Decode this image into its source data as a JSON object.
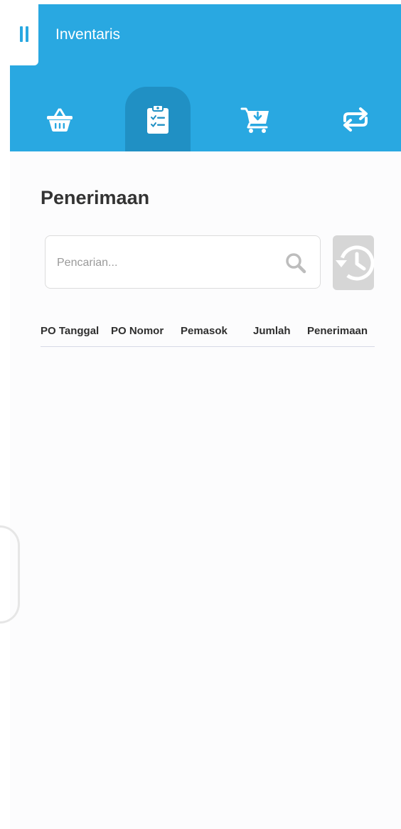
{
  "app": {
    "title": "Inventaris",
    "accent_color": "#29a8e1",
    "active_tab_color": "#2090c4"
  },
  "menu": {
    "icon": "menu-icon"
  },
  "tabs": [
    {
      "icon": "basket-icon",
      "active": false
    },
    {
      "icon": "clipboard-checklist-icon",
      "active": true
    },
    {
      "icon": "cart-download-icon",
      "active": false
    },
    {
      "icon": "swap-arrows-icon",
      "active": false
    }
  ],
  "page": {
    "title": "Penerimaan"
  },
  "search": {
    "placeholder": "Pencarian...",
    "value": "",
    "icon": "search-icon"
  },
  "history_button": {
    "icon": "history-icon"
  },
  "table": {
    "columns": [
      "PO Tanggal",
      "PO Nomor",
      "Pemasok",
      "Jumlah",
      "Penerimaan"
    ],
    "rows": []
  }
}
